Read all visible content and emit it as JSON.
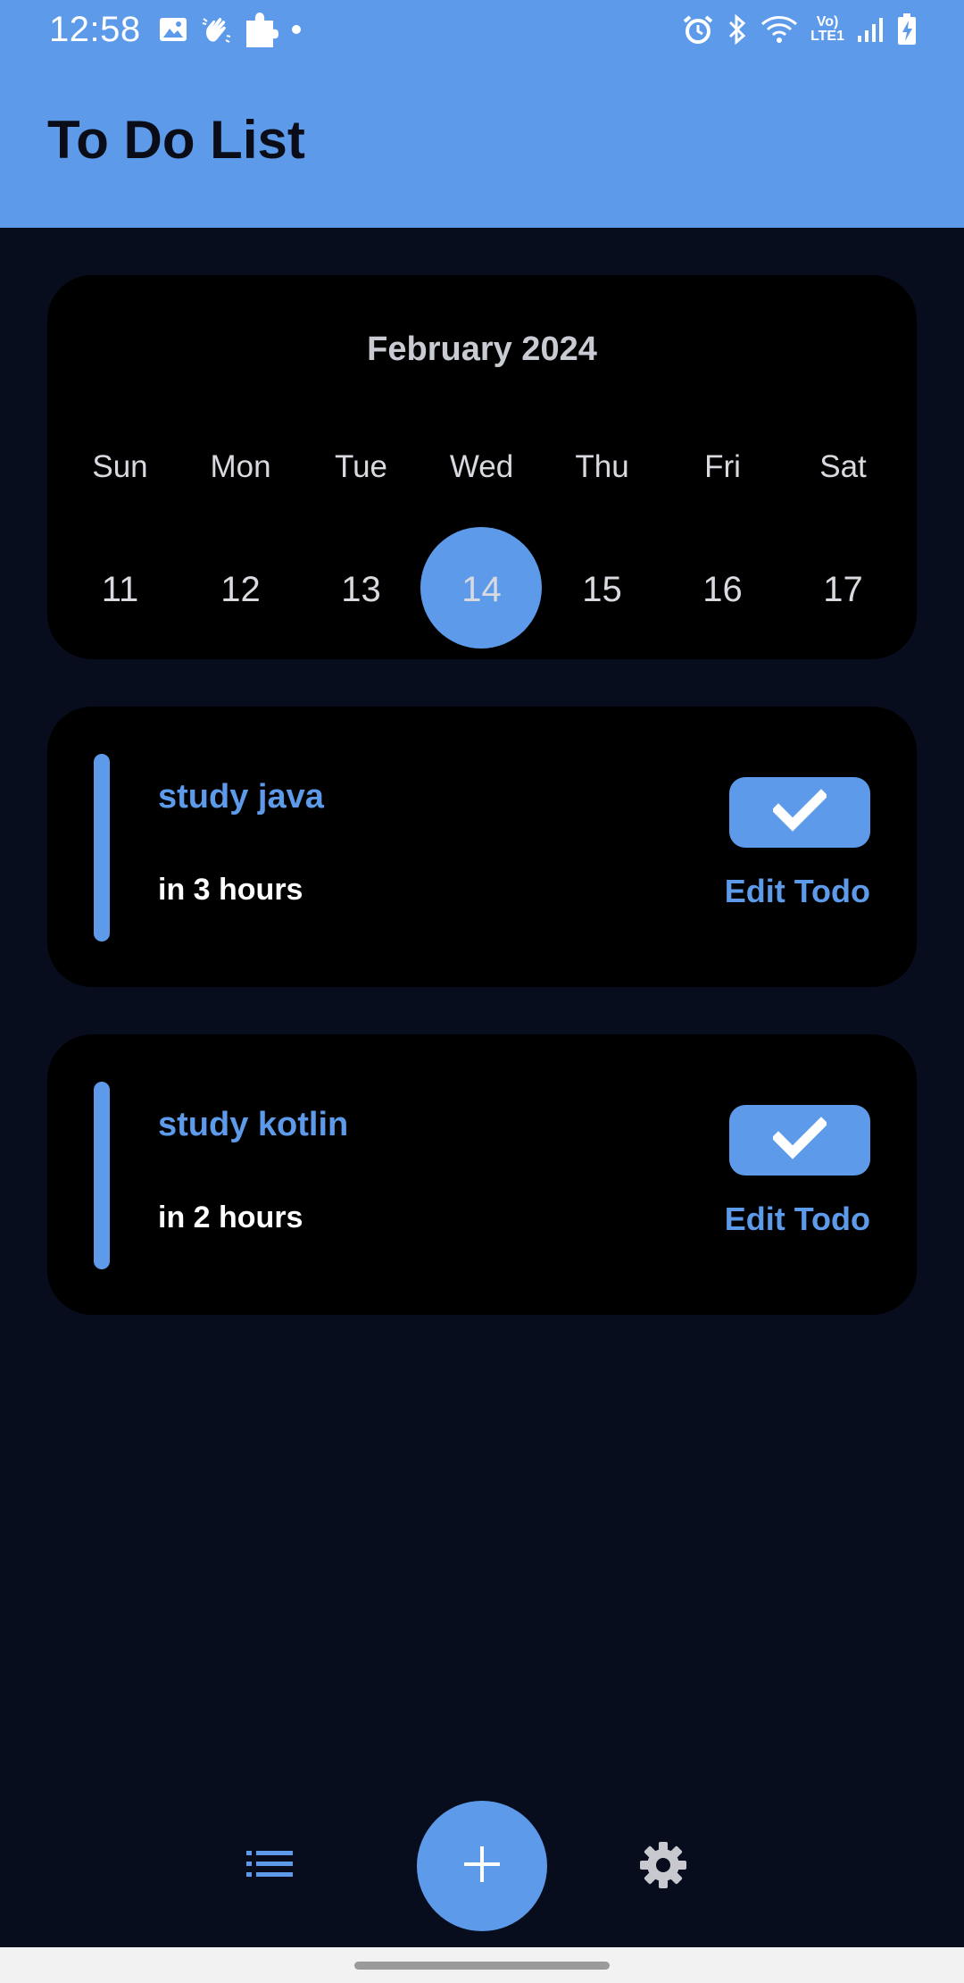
{
  "status_bar": {
    "time": "12:58",
    "left_icons": [
      "image-icon",
      "hand-wave-icon",
      "puzzle-icon",
      "dot-icon"
    ],
    "right_icons": [
      "alarm-icon",
      "bluetooth-icon",
      "wifi-icon",
      "volte-lte-icon",
      "signal-icon",
      "battery-charging-icon"
    ],
    "lte_top": "Vo)",
    "lte_bottom": "LTE1"
  },
  "app_bar": {
    "title": "To Do List"
  },
  "calendar": {
    "month": "February 2024",
    "weekdays": [
      "Sun",
      "Mon",
      "Tue",
      "Wed",
      "Thu",
      "Fri",
      "Sat"
    ],
    "days": [
      "11",
      "12",
      "13",
      "14",
      "15",
      "16",
      "17"
    ],
    "selected_day": "14"
  },
  "todos": [
    {
      "title": "study java",
      "due": "in 3 hours",
      "edit_label": "Edit Todo",
      "done_icon": "checkmark-icon"
    },
    {
      "title": "study kotlin",
      "due": "in 2 hours",
      "edit_label": "Edit Todo",
      "done_icon": "checkmark-icon"
    }
  ],
  "bottom_nav": {
    "left_icon": "list-icon",
    "fab_icon": "plus-icon",
    "right_icon": "gear-icon"
  },
  "colors": {
    "accent": "#5d9bea",
    "background": "#080d1d",
    "card": "#000000",
    "title_text": "#0a0d18"
  }
}
